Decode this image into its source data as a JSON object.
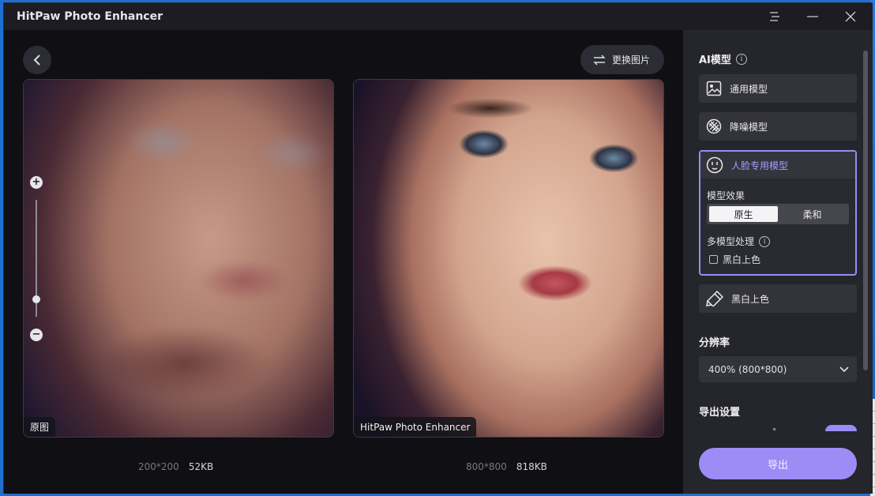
{
  "window": {
    "title": "HitPaw Photo Enhancer",
    "controls": {
      "menu": "menu-icon",
      "minimize": "minimize-icon",
      "close": "close-icon"
    }
  },
  "toolbar": {
    "back_icon": "chevron-left-icon",
    "swap_label": "更换图片",
    "swap_icon": "swap-arrows-icon"
  },
  "preview": {
    "original_label": "原图",
    "enhanced_label": "HitPaw Photo Enhancer",
    "original_dims": "200*200",
    "original_size": "52KB",
    "enhanced_dims": "800*800",
    "enhanced_size": "818KB",
    "zoom_level": 0.15
  },
  "sidebar": {
    "ai_model_title": "AI模型",
    "models": [
      {
        "label": "通用模型",
        "icon": "image-icon"
      },
      {
        "label": "降噪模型",
        "icon": "denoise-icon"
      },
      {
        "label": "人脸专用模型",
        "icon": "face-icon",
        "selected": true
      },
      {
        "label": "黑白上色",
        "icon": "colorize-icon"
      }
    ],
    "face_options": {
      "effect_label": "模型效果",
      "effect_options": [
        "原生",
        "柔和"
      ],
      "effect_selected": "原生",
      "multi_label": "多模型处理",
      "colorize_checkbox_label": "黑白上色",
      "colorize_checked": false
    },
    "resolution_title": "分辨率",
    "resolution_value": "400% (800*800)",
    "export_settings_title": "导出设置",
    "export_button": "导出",
    "accent_color": "#9d8cf6"
  }
}
